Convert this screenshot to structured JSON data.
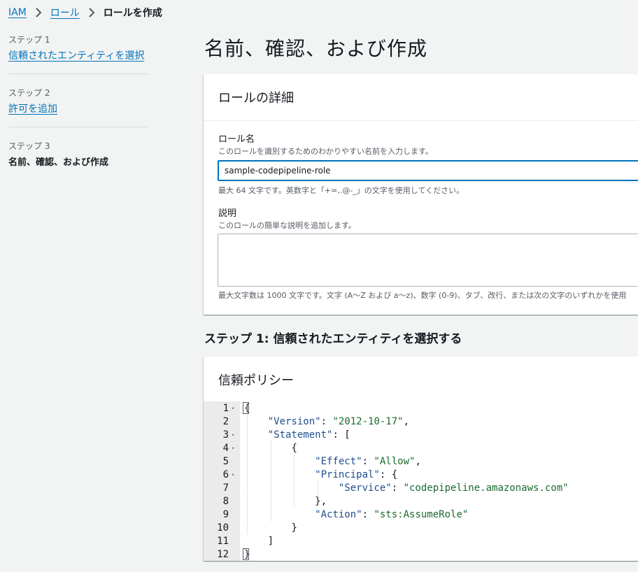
{
  "breadcrumb": {
    "items": [
      "IAM",
      "ロール"
    ],
    "current": "ロールを作成"
  },
  "steps": [
    {
      "label": "ステップ 1",
      "title": "信頼されたエンティティを選択"
    },
    {
      "label": "ステップ 2",
      "title": "許可を追加"
    },
    {
      "label": "ステップ 3",
      "title": "名前、確認、および作成"
    }
  ],
  "page": {
    "title": "名前、確認、および作成"
  },
  "role_details": {
    "header": "ロールの詳細",
    "name_label": "ロール名",
    "name_desc": "このロールを識別するためのわかりやすい名前を入力します。",
    "name_value": "sample-codepipeline-role",
    "name_constraint": "最大 64 文字です。英数字と「+=,.@-_」の文字を使用してください。",
    "desc_label": "説明",
    "desc_desc": "このロールの簡単な説明を追加します。",
    "desc_value": "",
    "desc_constraint": "最大文字数は 1000 文字です。文字 (A〜Z および a〜z)、数字 (0-9)、タブ、改行、または次の文字のいずれかを使用"
  },
  "step1_section": {
    "title": "ステップ 1: 信頼されたエンティティを選択する"
  },
  "trust_policy": {
    "header": "信頼ポリシー",
    "line_numbers": [
      "1",
      "2",
      "3",
      "4",
      "5",
      "6",
      "7",
      "8",
      "9",
      "10",
      "11",
      "12"
    ],
    "lines": [
      [
        "",
        "{"
      ],
      [
        "    ",
        "\"Version\"",
        ": ",
        "\"2012-10-17\"",
        ","
      ],
      [
        "    ",
        "\"Statement\"",
        ": ["
      ],
      [
        "        ",
        "{"
      ],
      [
        "            ",
        "\"Effect\"",
        ": ",
        "\"Allow\"",
        ","
      ],
      [
        "            ",
        "\"Principal\"",
        ": {"
      ],
      [
        "                ",
        "\"Service\"",
        ": ",
        "\"codepipeline.amazonaws.com\""
      ],
      [
        "            ",
        "},"
      ],
      [
        "            ",
        "\"Action\"",
        ": ",
        "\"sts:AssumeRole\""
      ],
      [
        "        ",
        "}"
      ],
      [
        "    ",
        "]"
      ],
      [
        "",
        "}"
      ]
    ]
  }
}
